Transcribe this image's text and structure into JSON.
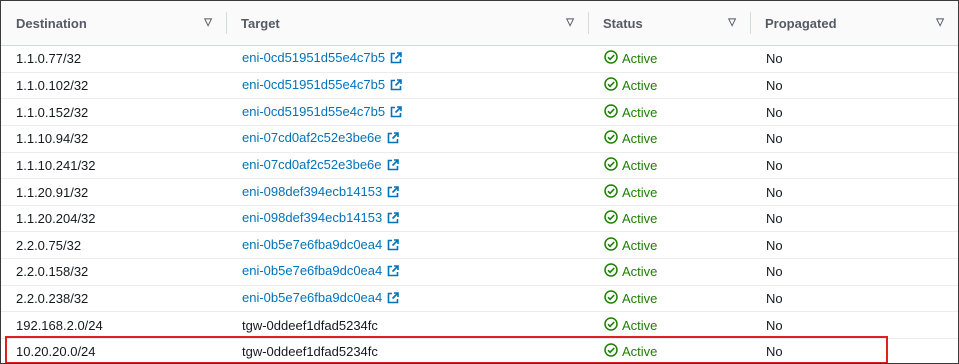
{
  "table": {
    "columns": [
      {
        "label": "Destination",
        "sort_icon": "sort-triangle-icon"
      },
      {
        "label": "Target",
        "sort_icon": "sort-triangle-icon"
      },
      {
        "label": "Status",
        "sort_icon": "sort-triangle-icon"
      },
      {
        "label": "Propagated",
        "sort_icon": "sort-triangle-icon"
      }
    ],
    "rows": [
      {
        "destination": "1.1.0.77/32",
        "target": "eni-0cd51951d55e4c7b5",
        "target_is_link": true,
        "status": "Active",
        "propagated": "No"
      },
      {
        "destination": "1.1.0.102/32",
        "target": "eni-0cd51951d55e4c7b5",
        "target_is_link": true,
        "status": "Active",
        "propagated": "No"
      },
      {
        "destination": "1.1.0.152/32",
        "target": "eni-0cd51951d55e4c7b5",
        "target_is_link": true,
        "status": "Active",
        "propagated": "No"
      },
      {
        "destination": "1.1.10.94/32",
        "target": "eni-07cd0af2c52e3be6e",
        "target_is_link": true,
        "status": "Active",
        "propagated": "No"
      },
      {
        "destination": "1.1.10.241/32",
        "target": "eni-07cd0af2c52e3be6e",
        "target_is_link": true,
        "status": "Active",
        "propagated": "No"
      },
      {
        "destination": "1.1.20.91/32",
        "target": "eni-098def394ecb14153",
        "target_is_link": true,
        "status": "Active",
        "propagated": "No"
      },
      {
        "destination": "1.1.20.204/32",
        "target": "eni-098def394ecb14153",
        "target_is_link": true,
        "status": "Active",
        "propagated": "No"
      },
      {
        "destination": "2.2.0.75/32",
        "target": "eni-0b5e7e6fba9dc0ea4",
        "target_is_link": true,
        "status": "Active",
        "propagated": "No"
      },
      {
        "destination": "2.2.0.158/32",
        "target": "eni-0b5e7e6fba9dc0ea4",
        "target_is_link": true,
        "status": "Active",
        "propagated": "No"
      },
      {
        "destination": "2.2.0.238/32",
        "target": "eni-0b5e7e6fba9dc0ea4",
        "target_is_link": true,
        "status": "Active",
        "propagated": "No"
      },
      {
        "destination": "192.168.2.0/24",
        "target": "tgw-0ddeef1dfad5234fc",
        "target_is_link": false,
        "status": "Active",
        "propagated": "No"
      },
      {
        "destination": "10.20.20.0/24",
        "target": "tgw-0ddeef1dfad5234fc",
        "target_is_link": false,
        "status": "Active",
        "propagated": "No",
        "highlighted": true
      }
    ]
  },
  "icons": {
    "external_link": "external-link-icon",
    "status_active": "check-circle-icon"
  },
  "colors": {
    "link": "#0073bb",
    "status_active": "#1d8102",
    "highlight_border": "#e0201e",
    "header_text": "#545b64"
  }
}
